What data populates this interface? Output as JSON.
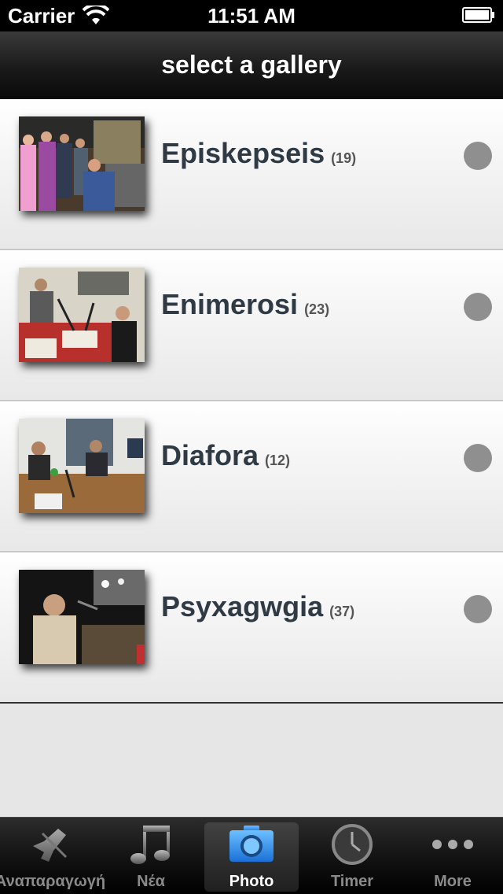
{
  "status_bar": {
    "carrier": "Carrier",
    "time": "11:51 AM"
  },
  "nav": {
    "title": "select a gallery"
  },
  "galleries": [
    {
      "title": "Episkepseis",
      "count": "(19)"
    },
    {
      "title": "Enimerosi",
      "count": "(23)"
    },
    {
      "title": "Diafora",
      "count": "(12)"
    },
    {
      "title": "Psyxagwgia",
      "count": "(37)"
    }
  ],
  "tabs": [
    {
      "label": "Αναπαραγωγή",
      "icon": "speaker-icon"
    },
    {
      "label": "Νέα",
      "icon": "music-note-icon"
    },
    {
      "label": "Photo",
      "icon": "camera-icon",
      "selected": true
    },
    {
      "label": "Timer",
      "icon": "clock-icon"
    },
    {
      "label": "More",
      "icon": "more-dots-icon"
    }
  ],
  "colors": {
    "nav_background": "#1a1a1a",
    "row_title": "#2f3a45",
    "indicator": "#8f8f8f",
    "tab_selected_icon": "#2f8fe8"
  }
}
